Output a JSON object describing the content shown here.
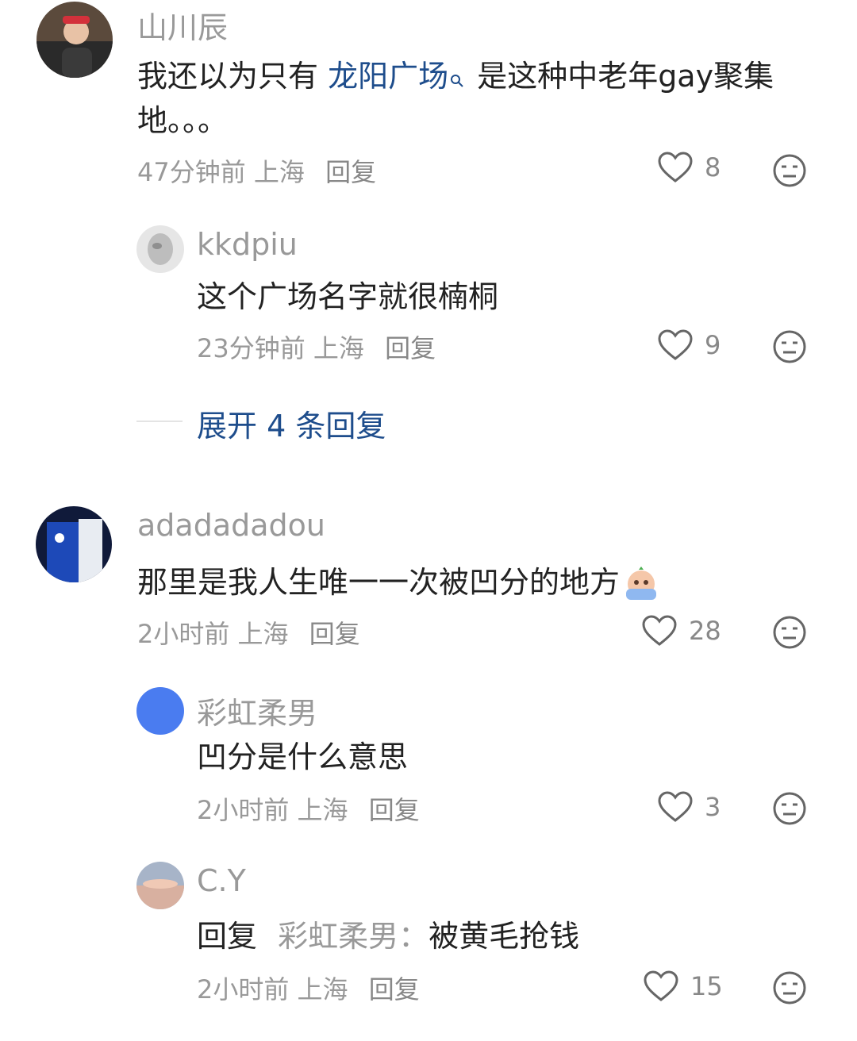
{
  "comments": [
    {
      "user": "山川辰",
      "text_before": "我还以为只有 ",
      "link_text": "龙阳广场",
      "text_after": " 是这种中老年gay聚集地。。。",
      "time": "47分钟前",
      "location": "上海",
      "reply_label": "回复",
      "likes": "8"
    },
    {
      "user": "kkdpiu",
      "text": "这个广场名字就很楠桐",
      "time": "23分钟前",
      "location": "上海",
      "reply_label": "回复",
      "likes": "9"
    },
    {
      "user": "adadadadou",
      "text": "那里是我人生唯一一次被凹分的地方",
      "time": "2小时前",
      "location": "上海",
      "reply_label": "回复",
      "likes": "28"
    },
    {
      "user": "彩虹柔男",
      "text": "凹分是什么意思",
      "time": "2小时前",
      "location": "上海",
      "reply_label": "回复",
      "likes": "3"
    },
    {
      "user": "C.Y",
      "reply_prefix": "回复",
      "reply_to": "彩虹柔男",
      "reply_colon": "：",
      "text": "被黄毛抢钱",
      "time": "2小时前",
      "location": "上海",
      "reply_label": "回复",
      "likes": "15"
    }
  ],
  "expand_replies": "展开 4 条回复"
}
